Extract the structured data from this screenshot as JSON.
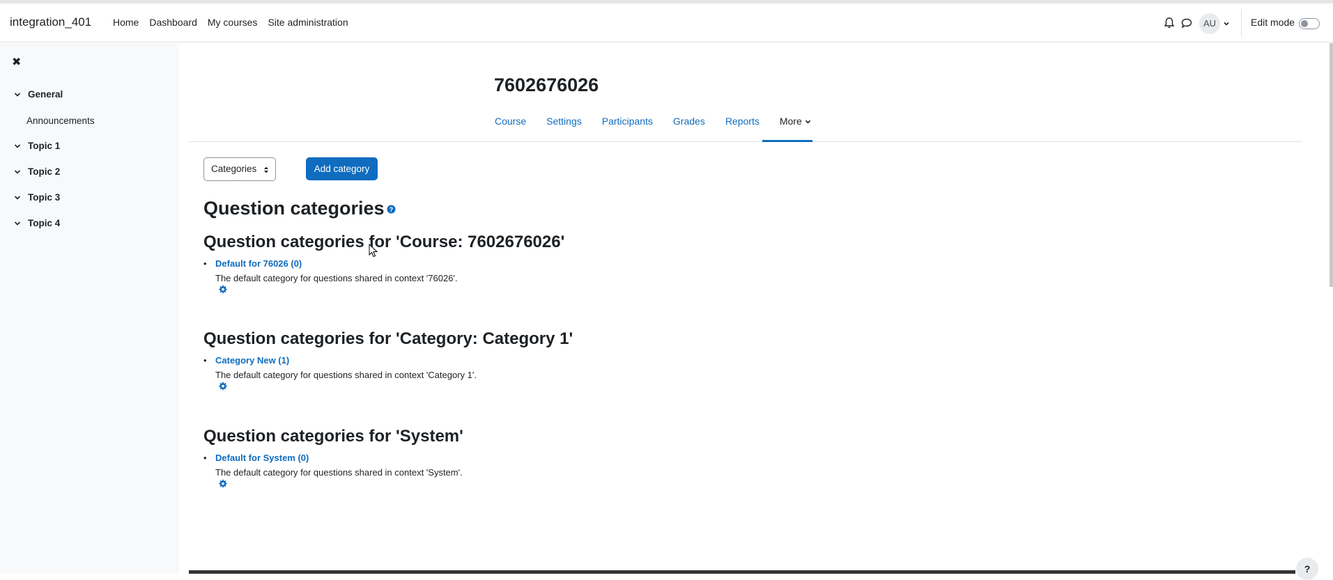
{
  "header": {
    "brand": "integration_401",
    "nav": [
      "Home",
      "Dashboard",
      "My courses",
      "Site administration"
    ],
    "avatar_initials": "AU",
    "edit_mode_label": "Edit mode",
    "edit_mode_on": false
  },
  "drawer": {
    "close_icon": "close-icon",
    "sections": [
      {
        "label": "General",
        "children": [
          "Announcements"
        ]
      },
      {
        "label": "Topic 1"
      },
      {
        "label": "Topic 2"
      },
      {
        "label": "Topic 3"
      },
      {
        "label": "Topic 4"
      }
    ]
  },
  "course": {
    "title": "7602676026",
    "tabs": [
      "Course",
      "Settings",
      "Participants",
      "Grades",
      "Reports",
      "More"
    ],
    "active_tab": "More"
  },
  "toolbar": {
    "select_value": "Categories",
    "add_button": "Add category"
  },
  "page_title": "Question categories",
  "groups": [
    {
      "heading": "Question categories for 'Course: 7602676026'",
      "category": "Default for 76026 (0)",
      "description": "The default category for questions shared in context '76026'."
    },
    {
      "heading": "Question categories for 'Category: Category 1'",
      "category": "Category New (1)",
      "description": "The default category for questions shared in context 'Category 1'."
    },
    {
      "heading": "Question categories for 'System'",
      "category": "Default for System (0)",
      "description": "The default category for questions shared in context 'System'."
    }
  ],
  "footer": {
    "help_label": "?"
  },
  "colors": {
    "link": "#0f6cbf",
    "primary": "#0f6cbf",
    "drawer_bg": "#f8f9fa"
  }
}
